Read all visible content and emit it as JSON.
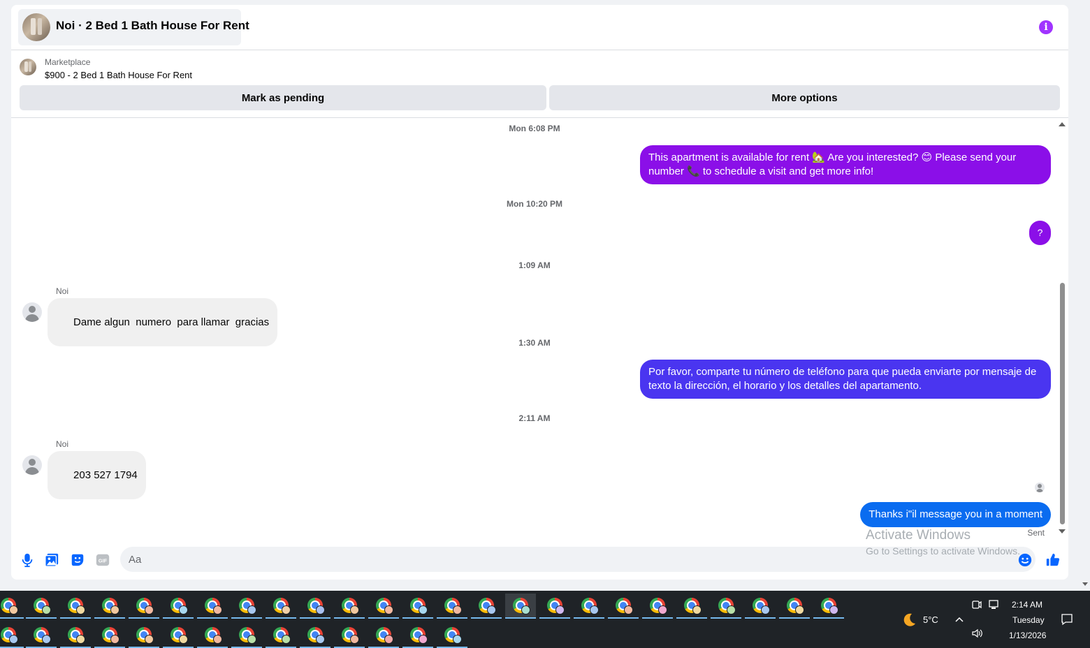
{
  "header": {
    "title": "Noi · 2 Bed 1 Bath House For Rent"
  },
  "marketplace": {
    "label": "Marketplace",
    "listing": "$900 - 2 Bed 1 Bath House For Rent",
    "mark_pending_label": "Mark as pending",
    "more_options_label": "More options"
  },
  "messages": [
    {
      "type": "timestamp",
      "text": "Mon 6:08 PM"
    },
    {
      "type": "out",
      "text": "This apartment is available for rent 🏡 Are you interested? 😊 Please send your number 📞 to schedule a visit and get more info!",
      "color": "#8b0fe8"
    },
    {
      "type": "timestamp",
      "text": "Mon 10:20 PM"
    },
    {
      "type": "out",
      "text": "?",
      "color": "#8b0fe8"
    },
    {
      "type": "timestamp",
      "text": "1:09 AM"
    },
    {
      "type": "in",
      "sender": "Noi",
      "text": "Dame algun  numero  para llamar  gracias"
    },
    {
      "type": "timestamp",
      "text": "1:30 AM"
    },
    {
      "type": "out",
      "text": "Por favor, comparte tu número de teléfono para que pueda enviarte por mensaje de texto la dirección, el horario y los detalles del apartamento.",
      "color": "#4a35f0"
    },
    {
      "type": "timestamp",
      "text": "2:11 AM"
    },
    {
      "type": "in",
      "sender": "Noi",
      "text": "203 527 1794"
    },
    {
      "type": "out",
      "text": "Thanks i\"il message you in a moment",
      "color": "#0a6cf0"
    }
  ],
  "status": {
    "sent_label": "Sent"
  },
  "composer": {
    "placeholder": "Aa",
    "value": ""
  },
  "watermark": {
    "line1": "Activate Windows",
    "line2": "Go to Settings to activate Windows."
  },
  "taskbar": {
    "weather_temp": "5°C",
    "time": "2:14 AM",
    "day": "Tuesday",
    "date": "1/13/2026",
    "row1_badge_colors": [
      "#f2c9a0",
      "#b8e0a8",
      "#f0d9a0",
      "#f2c9a0",
      "#f2b8a0",
      "#a8d8f0",
      "#f2b8a0",
      "#a8c8f0",
      "#f2d0a8",
      "#a8c0f0",
      "#f2c9a0",
      "#f2b8a0",
      "#a8d8f0",
      "#f2b8a0",
      "#a8c8f0",
      "#a8e0d0",
      "#d0b8f0",
      "#a8c8f0",
      "#f2b8a0",
      "#f2a8d0",
      "#f0d9a0",
      "#b8e0a8",
      "#a8c8f0",
      "#f0d9a0",
      "#d0b8f0"
    ],
    "row2_badge_colors": [
      "#a8c8f0",
      "#a8c8f0",
      "#f0d9a0",
      "#f2b8a0",
      "#f2c9a0",
      "#f0d9a0",
      "#f2b8a0",
      "#b8e0a8",
      "#b8e0a8",
      "#a8c8f0",
      "#f2b8a0",
      "#f2a8a8",
      "#f2a8d0",
      "#a8d8f0"
    ]
  }
}
